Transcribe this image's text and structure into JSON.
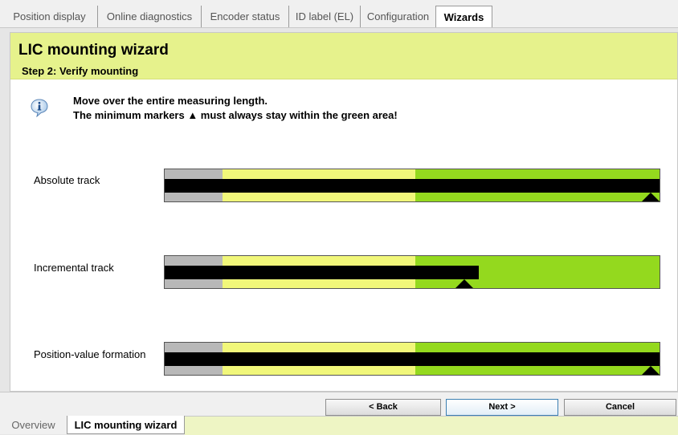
{
  "top_tabs": [
    {
      "label": "Position display",
      "active": false
    },
    {
      "label": "Online diagnostics",
      "active": false
    },
    {
      "label": "Encoder status",
      "active": false
    },
    {
      "label": "ID label (EL)",
      "active": false
    },
    {
      "label": "Configuration",
      "active": false
    },
    {
      "label": "Wizards",
      "active": true
    }
  ],
  "wizard": {
    "title": "LIC mounting wizard",
    "step": "Step 2: Verify mounting",
    "message_line1": "Move over the entire measuring length.",
    "message_line2": "The minimum markers ▲ must always stay within the green area!"
  },
  "tracks": [
    {
      "label": "Absolute track",
      "level_pct": 100,
      "marker_pct": 100
    },
    {
      "label": "Incremental track",
      "level_pct": 63.4,
      "marker_pct": 60.5
    },
    {
      "label": "Position-value formation",
      "level_pct": 100,
      "marker_pct": 100
    }
  ],
  "colors": {
    "gray_zone": "#b8b8b8",
    "yellow_zone": "#f1f77a",
    "green_zone": "#94d91e",
    "header_bg": "#e6f28c"
  },
  "buttons": {
    "back": "< Back",
    "next": "Next >",
    "cancel": "Cancel"
  },
  "bottom_tabs": [
    {
      "label": "Overview",
      "active": false
    },
    {
      "label": "LIC mounting wizard",
      "active": true
    }
  ],
  "icons": {
    "info": "info-icon",
    "marker": "triangle-up-icon"
  }
}
